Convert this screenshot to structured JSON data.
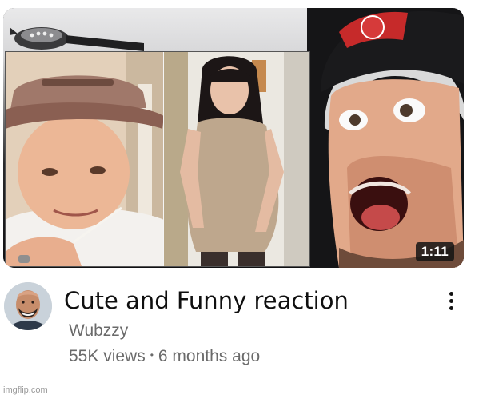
{
  "video": {
    "title": "Cute and Funny reaction",
    "channel": "Wubzzy",
    "views": "55K views",
    "separator": "•",
    "age": "6 months ago",
    "duration": "1:11"
  },
  "watermark": "imgflip.com",
  "icons": {
    "more": "more-vert-icon"
  },
  "colors": {
    "title": "#0f0f0f",
    "meta": "#6a6a6a",
    "badge_bg": "#141414",
    "badge_text": "#ffffff"
  }
}
